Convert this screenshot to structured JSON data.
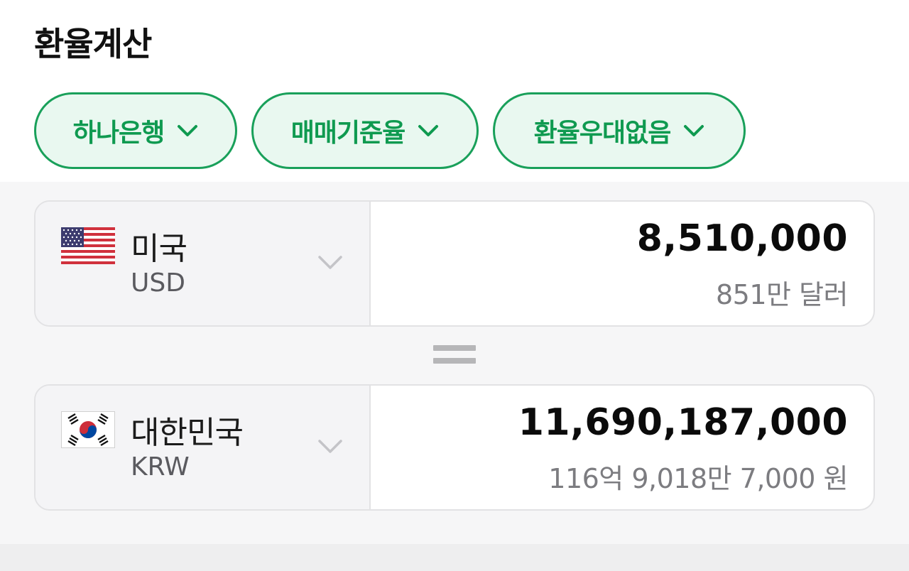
{
  "title": "환율계산",
  "filters": [
    {
      "label": "하나은행"
    },
    {
      "label": "매매기준율"
    },
    {
      "label": "환율우대없음"
    }
  ],
  "from": {
    "country": "미국",
    "code": "USD",
    "flag_icon": "us-flag-icon",
    "amount": "8,510,000",
    "amount_text": "851만 달러"
  },
  "to": {
    "country": "대한민국",
    "code": "KRW",
    "flag_icon": "kr-flag-icon",
    "amount": "11,690,187,000",
    "amount_text": "116억 9,018만 7,000 원"
  },
  "colors": {
    "accent": "#19a05a",
    "chip_bg": "#e9f8f0"
  }
}
